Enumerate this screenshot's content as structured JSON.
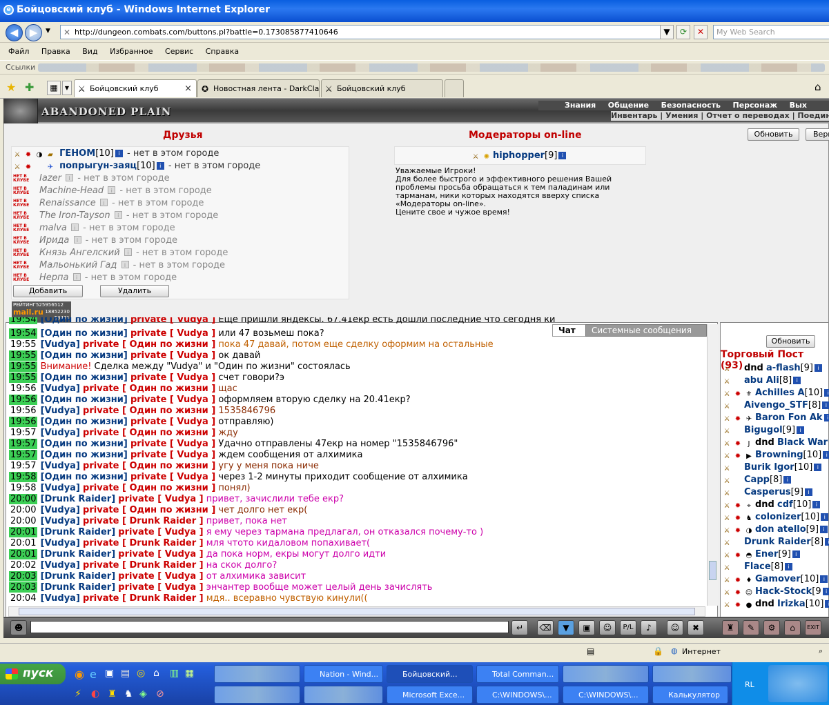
{
  "window": {
    "title": "Бойцовский клуб - Windows Internet Explorer"
  },
  "address": {
    "url": "http://dungeon.combats.com/buttons.pl?battle=0.173085877410646",
    "search_placeholder": "My Web Search"
  },
  "menu": [
    "Файл",
    "Правка",
    "Вид",
    "Избранное",
    "Сервис",
    "Справка"
  ],
  "links_label": "Ссылки",
  "tabs": [
    {
      "label": "Бойцовский клуб"
    },
    {
      "label": "Новостная лента - DarkClan"
    },
    {
      "label": "Бойцовский клуб"
    }
  ],
  "game": {
    "logo": "ABANDONED PLAIN",
    "topnav": [
      "Знания",
      "Общение",
      "Безопасность",
      "Персонаж",
      "Вых"
    ],
    "subnav": "Инвентарь | Умения | Отчет о переводах | Поединки",
    "refresh_label": "Обновить",
    "top_label": "Верн"
  },
  "friends": {
    "title": "Друзья",
    "online": [
      {
        "name": "ГЕНОМ",
        "level": "[10]",
        "status": " - нет в этом городе"
      },
      {
        "name": "попрыгун-заяц",
        "level": "[10]",
        "status": " - нет в этом городе"
      }
    ],
    "offline_tag": "НЕТ В КЛУБЕ",
    "offline": [
      {
        "name": "Iazer",
        "status": " - нет в этом городе"
      },
      {
        "name": "Machine-Head",
        "status": " - нет в этом городе"
      },
      {
        "name": "Renaissance",
        "status": " - нет в этом городе"
      },
      {
        "name": "The Iron-Tayson",
        "status": " - нет в этом городе"
      },
      {
        "name": "malva",
        "status": " - нет в этом городе"
      },
      {
        "name": "Ирида",
        "status": " - нет в этом городе"
      },
      {
        "name": "Князь Ангелский",
        "status": " - нет в этом городе"
      },
      {
        "name": "Мальонький Гад",
        "status": " - нет в этом городе"
      },
      {
        "name": "Нерпа",
        "status": " - нет в этом городе"
      }
    ],
    "add_label": "Добавить",
    "delete_label": "Удалить"
  },
  "moderators": {
    "title": "Модераторы on-line",
    "name": "hiphopper",
    "level": "[9]",
    "notice": [
      "Уважаемые Игроки!",
      "Для более быстрого и эффективного решения Вашей",
      "проблемы просьба обращаться к тем паладинам или",
      "тарманам, ники которых находятся вверху списка",
      "«Модераторы on-line».",
      "Цените свое и чужое время!"
    ]
  },
  "rating": {
    "label": "РЕЙТИНГ",
    "v1": "525956512",
    "brand": "mail.ru",
    "v2": "18852230",
    "v3": "53471"
  },
  "chat": {
    "tab_chat": "Чат",
    "tab_system": "Системные сообщения",
    "partial": {
      "time": "19:54",
      "from": "[Один по жизни]",
      "to": "private [ Vudya ]",
      "msg": "Еще пришли яндексы. 67.41екр есть дошли последние что сегодня ки"
    },
    "lines": [
      {
        "time": "19:54",
        "hl": true,
        "from": "[Один по жизни]",
        "to": "private [ Vudya ]",
        "msg": "или 47 возьмеш пока?",
        "c": "m4"
      },
      {
        "time": "19:55",
        "hl": false,
        "from": "[Vudya]",
        "to": "private [ Один по жизни ]",
        "msg": "пока 47 давай, потом еще сделку оформим на остальные",
        "c": "m2"
      },
      {
        "time": "19:55",
        "hl": true,
        "from": "[Один по жизни]",
        "to": "private [ Vudya ]",
        "msg": "ок давай",
        "c": "m4"
      },
      {
        "time": "19:55",
        "hl": true,
        "warn": "Внимание!",
        "msg": " Сделка между \"Vudya\" и \"Один по жизни\" состоялась",
        "c": "m4"
      },
      {
        "time": "19:55",
        "hl": true,
        "from": "[Один по жизни]",
        "to": "private [ Vudya ]",
        "msg": "счет говори?э",
        "c": "m4"
      },
      {
        "time": "19:56",
        "hl": false,
        "from": "[Vudya]",
        "to": "private [ Один по жизни ]",
        "msg": "щас",
        "c": "m1"
      },
      {
        "time": "19:56",
        "hl": true,
        "from": "[Один по жизни]",
        "to": "private [ Vudya ]",
        "msg": "оформляем вторую сделку на 20.41екр?",
        "c": "m4"
      },
      {
        "time": "19:56",
        "hl": false,
        "from": "[Vudya]",
        "to": "private [ Один по жизни ]",
        "msg": "1535846796",
        "c": "m1"
      },
      {
        "time": "19:56",
        "hl": true,
        "from": "[Один по жизни]",
        "to": "private [ Vudya ]",
        "msg": "отправляю)",
        "c": "m4"
      },
      {
        "time": "19:57",
        "hl": false,
        "from": "[Vudya]",
        "to": "private [ Один по жизни ]",
        "msg": "жду",
        "c": "m1"
      },
      {
        "time": "19:57",
        "hl": true,
        "from": "[Один по жизни]",
        "to": "private [ Vudya ]",
        "msg": "Удачно отправлены 47екр на номер \"1535846796\"",
        "c": "m4"
      },
      {
        "time": "19:57",
        "hl": true,
        "from": "[Один по жизни]",
        "to": "private [ Vudya ]",
        "msg": "ждем сообщения от алхимика",
        "c": "m4"
      },
      {
        "time": "19:57",
        "hl": false,
        "from": "[Vudya]",
        "to": "private [ Один по жизни ]",
        "msg": "угу у меня пока ниче",
        "c": "m1"
      },
      {
        "time": "19:58",
        "hl": true,
        "from": "[Один по жизни]",
        "to": "private [ Vudya ]",
        "msg": "через 1-2 минуты приходит сообщение от алхимика",
        "c": "m4"
      },
      {
        "time": "19:58",
        "hl": false,
        "from": "[Vudya]",
        "to": "private [ Один по жизни ]",
        "msg": "понял)",
        "c": "m1"
      },
      {
        "time": "20:00",
        "hl": true,
        "from": "[Drunk Raider]",
        "to": "private [ Vudya ]",
        "msg": "привет, зачислили тебе екр?",
        "c": "m3"
      },
      {
        "time": "20:00",
        "hl": false,
        "from": "[Vudya]",
        "to": "private [ Один по жизни ]",
        "msg": "чет долго нет екр(",
        "c": "m1"
      },
      {
        "time": "20:00",
        "hl": false,
        "from": "[Vudya]",
        "to": "private [ Drunk Raider ]",
        "msg": "привет, пока нет",
        "c": "m3"
      },
      {
        "time": "20:01",
        "hl": true,
        "from": "[Drunk Raider]",
        "to": "private [ Vudya ]",
        "msg": "я ему через тармана предлагал, он отказался почему-то )",
        "c": "m3"
      },
      {
        "time": "20:01",
        "hl": false,
        "from": "[Vudya]",
        "to": "private [ Drunk Raider ]",
        "msg": "мля чтото кидаловом попахивает(",
        "c": "m3"
      },
      {
        "time": "20:01",
        "hl": true,
        "from": "[Drunk Raider]",
        "to": "private [ Vudya ]",
        "msg": "да пока норм, екры могут долго идти",
        "c": "m3"
      },
      {
        "time": "20:02",
        "hl": false,
        "from": "[Vudya]",
        "to": "private [ Drunk Raider ]",
        "msg": "на скок долго?",
        "c": "m3"
      },
      {
        "time": "20:03",
        "hl": true,
        "from": "[Drunk Raider]",
        "to": "private [ Vudya ]",
        "msg": "от алхимика зависит",
        "c": "m3"
      },
      {
        "time": "20:03",
        "hl": true,
        "from": "[Drunk Raider]",
        "to": "private [ Vudya ]",
        "msg": "энчантер вообще может целый день зачислять",
        "c": "m3"
      },
      {
        "time": "20:04",
        "hl": false,
        "from": "[Vudya]",
        "to": "private [ Drunk Raider ]",
        "msg": "мдя.. всеравно чувствую кинули((",
        "c": "m2"
      }
    ]
  },
  "trade": {
    "refresh_label": "Обновить",
    "title": "Торговый Пост (93)",
    "users": [
      {
        "pre": "dnd",
        "name": "a-flash",
        "level": "[9]"
      },
      {
        "pre": "",
        "name": "abu Ali",
        "level": "[8]"
      },
      {
        "pre": "",
        "name": "Achilles A",
        "level": "[10]"
      },
      {
        "pre": "",
        "name": "Aivengo_STF",
        "level": "[8]"
      },
      {
        "pre": "",
        "name": "Baron Fon Ak",
        "level": ""
      },
      {
        "pre": "",
        "name": "Bigugol",
        "level": "[9]"
      },
      {
        "pre": "dnd",
        "name": "Black War",
        "level": ""
      },
      {
        "pre": "",
        "name": "Browning",
        "level": "[10]"
      },
      {
        "pre": "",
        "name": "Burik Igor",
        "level": "[10]"
      },
      {
        "pre": "",
        "name": "Capp",
        "level": "[8]"
      },
      {
        "pre": "",
        "name": "Casperus",
        "level": "[9]"
      },
      {
        "pre": "dnd",
        "name": "cdf",
        "level": "[10]"
      },
      {
        "pre": "",
        "name": "colonizer",
        "level": "[10]"
      },
      {
        "pre": "",
        "name": "don atello",
        "level": "[9]"
      },
      {
        "pre": "",
        "name": "Drunk Raider",
        "level": "[8]"
      },
      {
        "pre": "",
        "name": "Ener",
        "level": "[9]"
      },
      {
        "pre": "",
        "name": "Flace",
        "level": "[8]"
      },
      {
        "pre": "",
        "name": "Gamover",
        "level": "[10]"
      },
      {
        "pre": "",
        "name": "Hack-Stock",
        "level": "[9"
      },
      {
        "pre": "dnd",
        "name": "Irizka",
        "level": "[10]"
      }
    ]
  },
  "status": {
    "zone": "Интернет"
  },
  "taskbar": {
    "start": "пуск",
    "lang": "RL",
    "tasks": [
      "Nation - Wind...",
      "Бойцовский...",
      "Total Comman...",
      "Microsoft Exce...",
      "C:\\WINDOWS\\...",
      "C:\\WINDOWS\\...",
      "Калькулятор"
    ]
  }
}
